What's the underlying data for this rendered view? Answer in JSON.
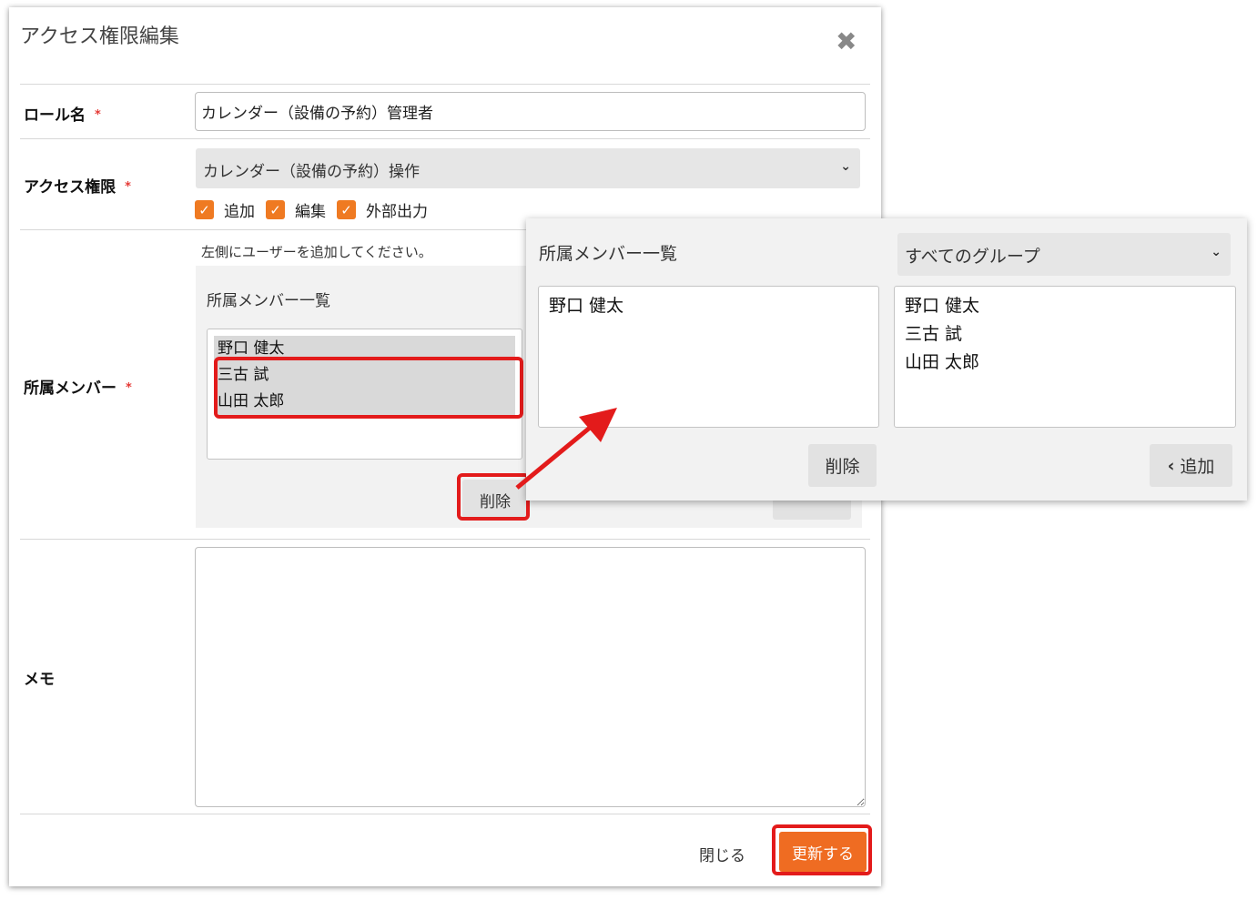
{
  "dialog": {
    "title": "アクセス権限編集",
    "close_icon": "close-icon",
    "role_name": {
      "label": "ロール名",
      "required_mark": "*",
      "value": "カレンダー（設備の予約）管理者"
    },
    "access": {
      "label": "アクセス権限",
      "required_mark": "*",
      "select_value": "カレンダー（設備の予約）操作",
      "checkboxes": [
        {
          "label": "追加",
          "checked": true
        },
        {
          "label": "編集",
          "checked": true
        },
        {
          "label": "外部出力",
          "checked": true
        }
      ]
    },
    "members": {
      "label": "所属メンバー",
      "required_mark": "*",
      "hint": "左側にユーザーを追加してください。",
      "list_title": "所属メンバー一覧",
      "items": [
        {
          "name": "野口 健太",
          "selected": true
        },
        {
          "name": "三古 試",
          "selected": true
        },
        {
          "name": "山田 太郎",
          "selected": true
        }
      ],
      "delete_label": "削除"
    },
    "memo": {
      "label": "メモ",
      "value": ""
    },
    "footer": {
      "close_label": "閉じる",
      "update_label": "更新する"
    }
  },
  "zoom": {
    "list_title": "所属メンバー一覧",
    "group_select": "すべてのグループ",
    "left_items": [
      "野口 健太"
    ],
    "right_items": [
      "野口 健太",
      "三古 試",
      "山田 太郎"
    ],
    "delete_label": "削除",
    "add_label": "追加",
    "add_icon": "chevron-left-icon"
  },
  "colors": {
    "accent": "#ef6c22",
    "highlight": "#e31b1b",
    "panel": "#f2f2f2"
  }
}
